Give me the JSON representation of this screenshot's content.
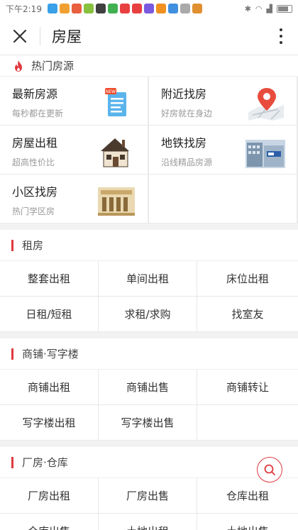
{
  "status_bar": {
    "time": "下午2:19",
    "app_icon_colors": [
      "#3aa0e8",
      "#f0a030",
      "#e86040",
      "#88c040",
      "#404040",
      "#40b050",
      "#e84040",
      "#e84040",
      "#7a5ae0",
      "#f09020",
      "#4090e0",
      "#aaaaaa",
      "#e09030"
    ]
  },
  "header": {
    "title": "房屋"
  },
  "hot": {
    "title": "热门房源",
    "items": [
      {
        "title": "最新房源",
        "subtitle": "每秒都在更新",
        "icon": "new-document-icon"
      },
      {
        "title": "附近找房",
        "subtitle": "好房就在身边",
        "icon": "map-pin-icon"
      },
      {
        "title": "房屋出租",
        "subtitle": "超高性价比",
        "icon": "house-icon"
      },
      {
        "title": "地铁找房",
        "subtitle": "沿线精品房源",
        "icon": "metro-building-icon"
      },
      {
        "title": "小区找房",
        "subtitle": "热门学区房",
        "icon": "community-building-icon"
      }
    ]
  },
  "sections": [
    {
      "title": "租房",
      "items": [
        "整套出租",
        "单间出租",
        "床位出租",
        "日租/短租",
        "求租/求购",
        "找室友"
      ]
    },
    {
      "title": "商铺·写字楼",
      "items": [
        "商铺出租",
        "商铺出售",
        "商铺转让",
        "写字楼出租",
        "写字楼出售",
        ""
      ]
    },
    {
      "title": "厂房·仓库",
      "items": [
        "厂房出租",
        "厂房出售",
        "仓库出租",
        "仓库出售",
        "土地出租",
        "土地出售"
      ]
    }
  ],
  "colors": {
    "accent": "#e0393e"
  }
}
